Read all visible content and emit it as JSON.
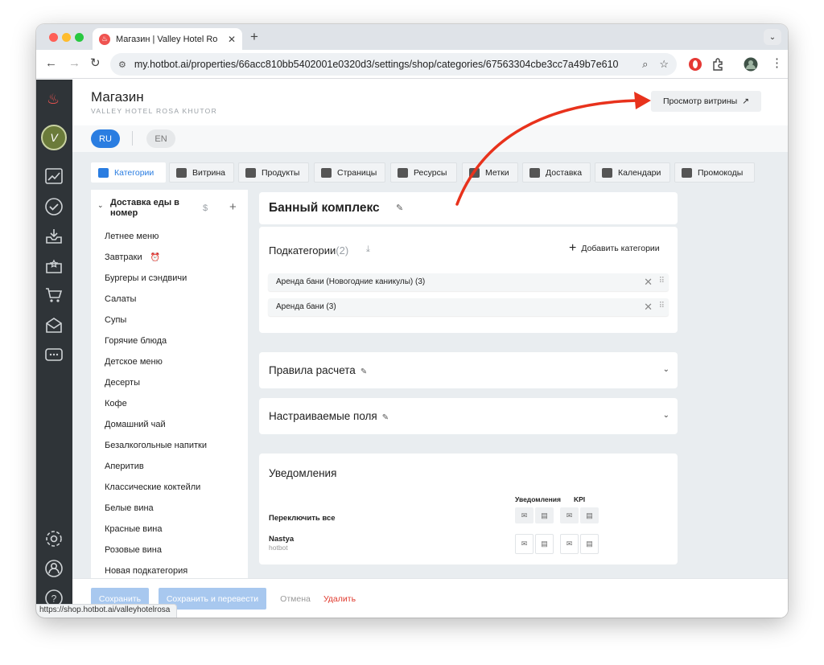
{
  "browser": {
    "tab_title": "Магазин | Valley Hotel Rosa Khutor",
    "url": "my.hotbot.ai/properties/66acc810bb5402001e0320d3/settings/shop/categories/67563304cbe3cc7a49b7e610",
    "status_url": "https://shop.hotbot.ai/valleyhotelrosa"
  },
  "header": {
    "title": "Магазин",
    "subtitle": "VALLEY HOTEL ROSA KHUTOR",
    "view_button": "Просмотр витрины",
    "view_icon": "↗"
  },
  "languages": {
    "ru": "RU",
    "en": "EN"
  },
  "tabs": [
    {
      "label": "Категории"
    },
    {
      "label": "Витрина"
    },
    {
      "label": "Продукты"
    },
    {
      "label": "Страницы"
    },
    {
      "label": "Ресурсы"
    },
    {
      "label": "Метки"
    },
    {
      "label": "Доставка"
    },
    {
      "label": "Календари"
    },
    {
      "label": "Промокоды"
    }
  ],
  "category_list": {
    "group_title": "Доставка еды в номер",
    "dollar": "$",
    "plus": "+",
    "items": [
      "Летнее меню",
      "Завтраки",
      "Бургеры и сэндвичи",
      "Салаты",
      "Супы",
      "Горячие блюда",
      "Детское меню",
      "Десерты",
      "Кофе",
      "Домашний чай",
      "Безалкогольные напитки",
      "Аперитив",
      "Классические коктейли",
      "Белые вина",
      "Красные вина",
      "Розовые вина",
      "Новая подкатегория"
    ]
  },
  "category": {
    "title": "Банный комплекс",
    "subcategories_label": "Подкатегории",
    "subcategories_count": "(2)",
    "add_label": "Добавить категории",
    "subcategories": [
      "Аренда бани (Новогодние каникулы) (3)",
      "Аренда бани (3)"
    ]
  },
  "sections": {
    "pricing_rules": "Правила расчета",
    "custom_fields": "Настраиваемые поля"
  },
  "notifications": {
    "title": "Уведомления",
    "col_notifications": "Уведомления",
    "col_kpi": "KPI",
    "toggle_all": "Переключить все",
    "user_name": "Nastya",
    "user_sub": "hotbot"
  },
  "footer": {
    "save": "Сохранить",
    "save_translate": "Сохранить и перевести",
    "cancel": "Отмена",
    "delete": "Удалить"
  },
  "colors": {
    "accent": "#2a7de1",
    "sidebar": "#2f3438",
    "danger": "#e03a2e",
    "annotation_arrow": "#e8321c"
  }
}
